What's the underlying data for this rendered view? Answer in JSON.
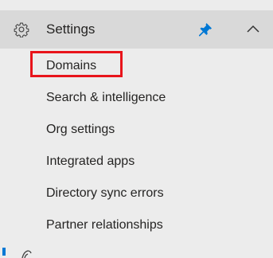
{
  "nav": {
    "section": {
      "title": "Settings",
      "icon": "gear-icon",
      "pin_icon": "pin-icon",
      "toggle_icon": "chevron-up-icon",
      "expanded": true
    },
    "items": [
      {
        "label": "Domains",
        "highlighted": true
      },
      {
        "label": "Search & intelligence"
      },
      {
        "label": "Org settings"
      },
      {
        "label": "Integrated apps"
      },
      {
        "label": "Directory sync errors"
      },
      {
        "label": "Partner relationships"
      }
    ]
  },
  "colors": {
    "background": "#ececec",
    "section_header_bg": "#d9d9d9",
    "highlight_border": "#e8141b",
    "accent": "#0078d4",
    "pin": "#0078d4",
    "text": "#252423"
  }
}
